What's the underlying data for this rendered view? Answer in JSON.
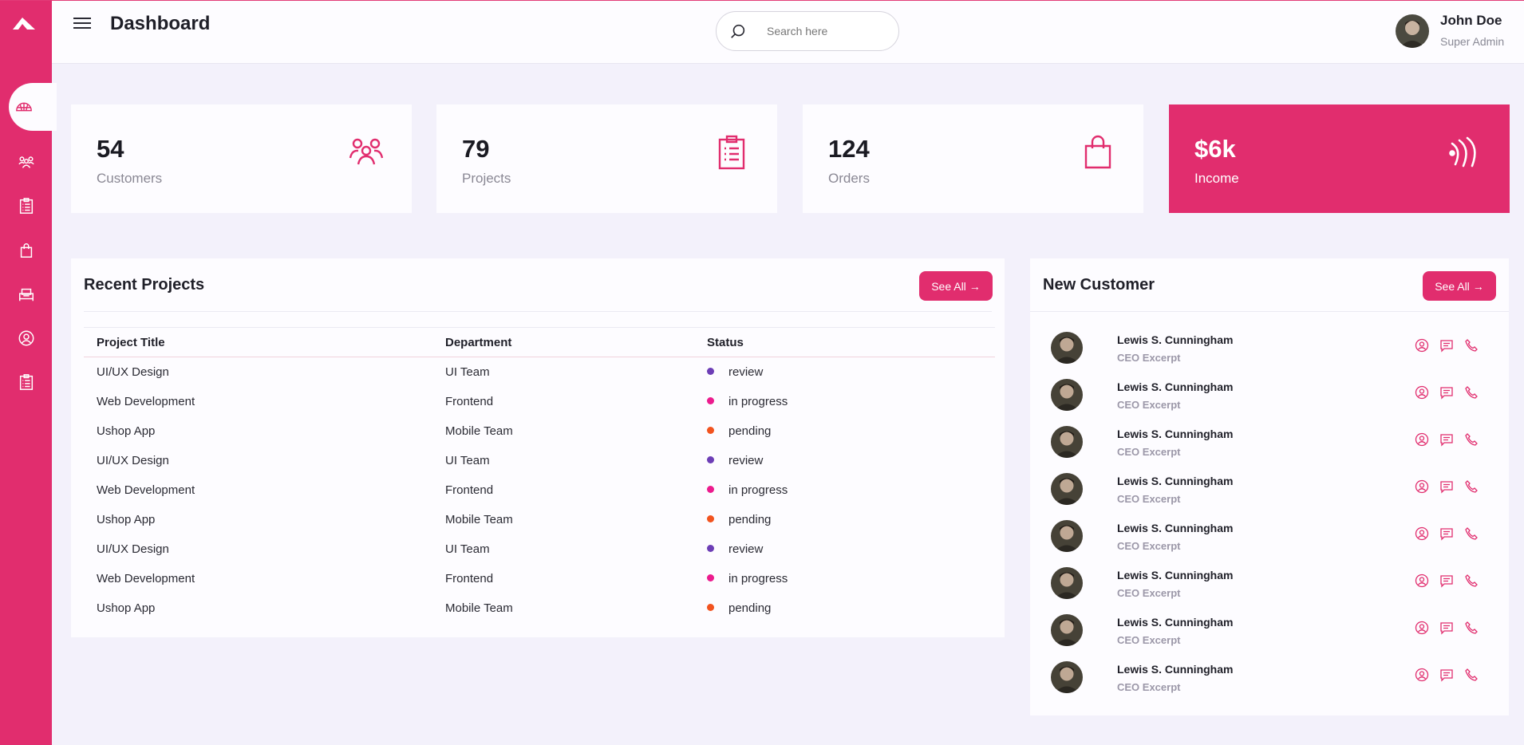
{
  "colors": {
    "accent": "#e12d6e",
    "review": "#6d3eb6",
    "in_progress": "#ec1b8e",
    "pending": "#f2531f"
  },
  "sidebar": {
    "items": [
      {
        "icon": "dashboard-icon",
        "active": true
      },
      {
        "icon": "customers-icon"
      },
      {
        "icon": "projects-icon"
      },
      {
        "icon": "orders-icon"
      },
      {
        "icon": "inventory-icon"
      },
      {
        "icon": "account-icon"
      },
      {
        "icon": "tasks-icon"
      }
    ]
  },
  "header": {
    "title": "Dashboard",
    "search_placeholder": "Search here",
    "user": {
      "name": "John Doe",
      "role": "Super Admin"
    }
  },
  "stats": [
    {
      "value": "54",
      "label": "Customers",
      "icon": "customers-icon"
    },
    {
      "value": "79",
      "label": "Projects",
      "icon": "clipboard-icon"
    },
    {
      "value": "124",
      "label": "Orders",
      "icon": "shopping-bag-icon"
    },
    {
      "value": "$6k",
      "label": "Income",
      "icon": "wifi-signal-icon"
    }
  ],
  "recent_projects": {
    "title": "Recent Projects",
    "see_all": "See All",
    "columns": [
      "Project Title",
      "Department",
      "Status"
    ],
    "rows": [
      {
        "title": "UI/UX Design",
        "department": "UI Team",
        "status": "review"
      },
      {
        "title": "Web Development",
        "department": "Frontend",
        "status": "in progress"
      },
      {
        "title": "Ushop App",
        "department": "Mobile Team",
        "status": "pending"
      },
      {
        "title": "UI/UX Design",
        "department": "UI Team",
        "status": "review"
      },
      {
        "title": "Web Development",
        "department": "Frontend",
        "status": "in progress"
      },
      {
        "title": "Ushop App",
        "department": "Mobile Team",
        "status": "pending"
      },
      {
        "title": "UI/UX Design",
        "department": "UI Team",
        "status": "review"
      },
      {
        "title": "Web Development",
        "department": "Frontend",
        "status": "in progress"
      },
      {
        "title": "Ushop App",
        "department": "Mobile Team",
        "status": "pending"
      }
    ]
  },
  "new_customer": {
    "title": "New Customer",
    "see_all": "See All",
    "items": [
      {
        "name": "Lewis S. Cunningham",
        "role": "CEO Excerpt"
      },
      {
        "name": "Lewis S. Cunningham",
        "role": "CEO Excerpt"
      },
      {
        "name": "Lewis S. Cunningham",
        "role": "CEO Excerpt"
      },
      {
        "name": "Lewis S. Cunningham",
        "role": "CEO Excerpt"
      },
      {
        "name": "Lewis S. Cunningham",
        "role": "CEO Excerpt"
      },
      {
        "name": "Lewis S. Cunningham",
        "role": "CEO Excerpt"
      },
      {
        "name": "Lewis S. Cunningham",
        "role": "CEO Excerpt"
      },
      {
        "name": "Lewis S. Cunningham",
        "role": "CEO Excerpt"
      }
    ]
  }
}
